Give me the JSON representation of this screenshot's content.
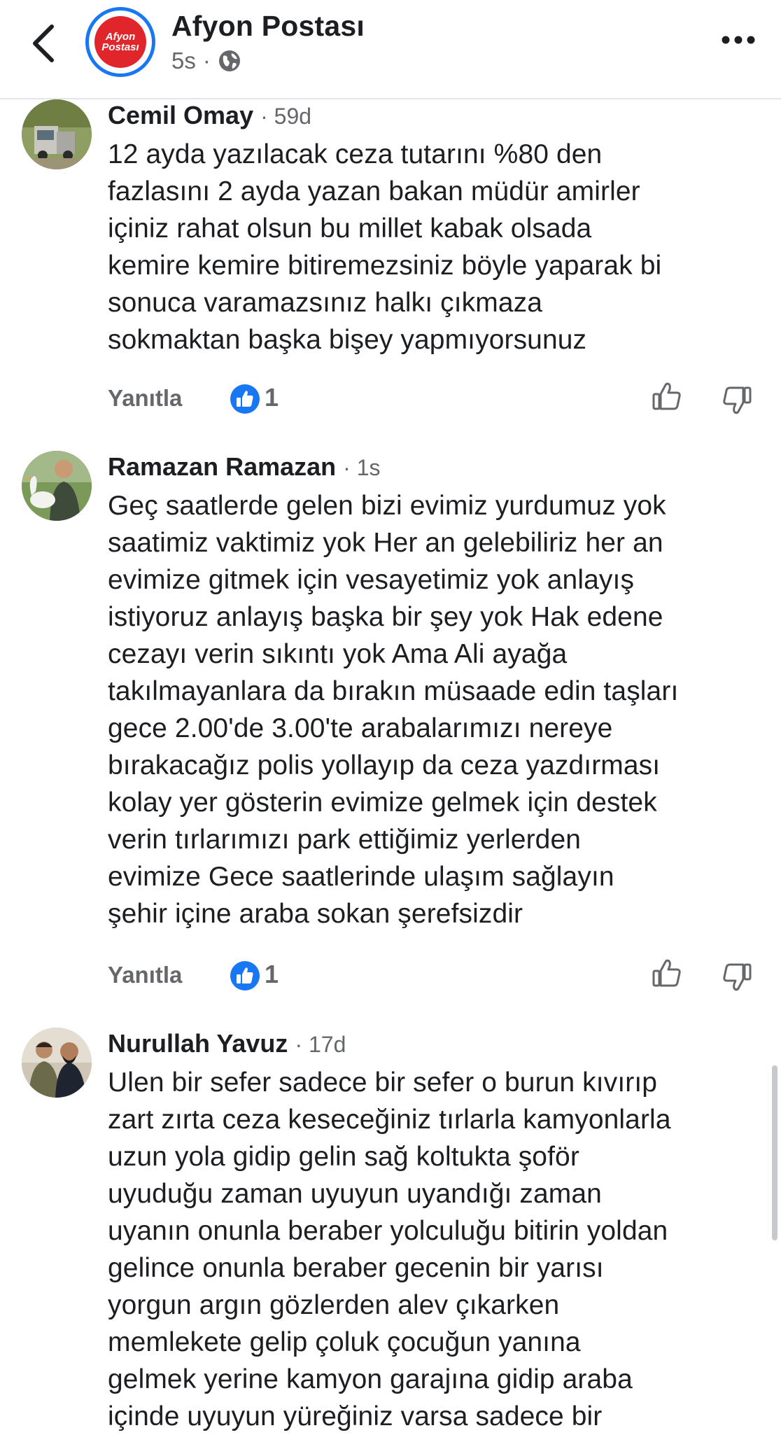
{
  "header": {
    "page_name": "Afyon Postası",
    "time": "5s",
    "separator": "·",
    "logo_text_1": "Afyon",
    "logo_text_2": "Postası"
  },
  "comments": [
    {
      "author": "Cemil Omay",
      "age": "· 59d",
      "text": "12 ayda yazılacak ceza tutarını %80 den\nfazlasını 2 ayda yazan bakan müdür amirler\niçiniz rahat olsun  bu millet kabak olsada\nkemire kemire bitiremezsiniz böyle yaparak bi\nsonuca varamazsınız halkı çıkmaza\nsokmaktan başka bişey yapmıyorsunuz",
      "reply_label": "Yanıtla",
      "like_count": "1"
    },
    {
      "author": "Ramazan Ramazan",
      "age": "· 1s",
      "text": "Geç saatlerde gelen bizi evimiz yurdumuz yok\nsaatimiz vaktimiz yok Her an gelebiliriz her an\nevimize gitmek için vesayetimiz yok anlayış\nistiyoruz anlayış başka bir şey yok Hak edene\ncezayı verin sıkıntı yok Ama Ali ayağa\ntakılmayanlara da bırakın müsaade edin taşları\ngece 2.00'de 3.00'te arabalarımızı nereye\nbırakacağız polis yollayıp da ceza yazdırması\nkolay yer gösterin evimize gelmek için destek\nverin tırlarımızı park ettiğimiz yerlerden\nevimize Gece saatlerinde ulaşım sağlayın\nşehir içine araba sokan şerefsizdir",
      "reply_label": "Yanıtla",
      "like_count": "1"
    },
    {
      "author": "Nurullah Yavuz",
      "age": "· 17d",
      "text": "Ulen bir sefer sadece bir sefer o burun kıvırıp\nzart zırta ceza keseceğiniz tırlarla kamyonlarla\nuzun yola gidip gelin sağ koltukta şoför\nuyuduğu zaman uyuyun uyandığı zaman\nuyanın onunla beraber yolculuğu bitirin yoldan\ngelince onunla beraber gecenin bir yarısı\nyorgun argın gözlerden alev çıkarken\nmemlekete gelip çoluk çocuğun yanına\ngelmek yerine kamyon garajına gidip araba\niçinde uyuyun yüreğiniz varsa sadece bir"
    }
  ],
  "icons": {
    "back": "chevron-left-icon",
    "globe": "globe-icon",
    "more": "more-horizontal-icon",
    "like_badge": "like-badge-icon",
    "thumb_up": "thumb-up-icon",
    "thumb_down": "thumb-down-icon"
  },
  "colors": {
    "accent": "#1877f2",
    "secondary_text": "#65676b",
    "logo_red": "#e0252b"
  }
}
